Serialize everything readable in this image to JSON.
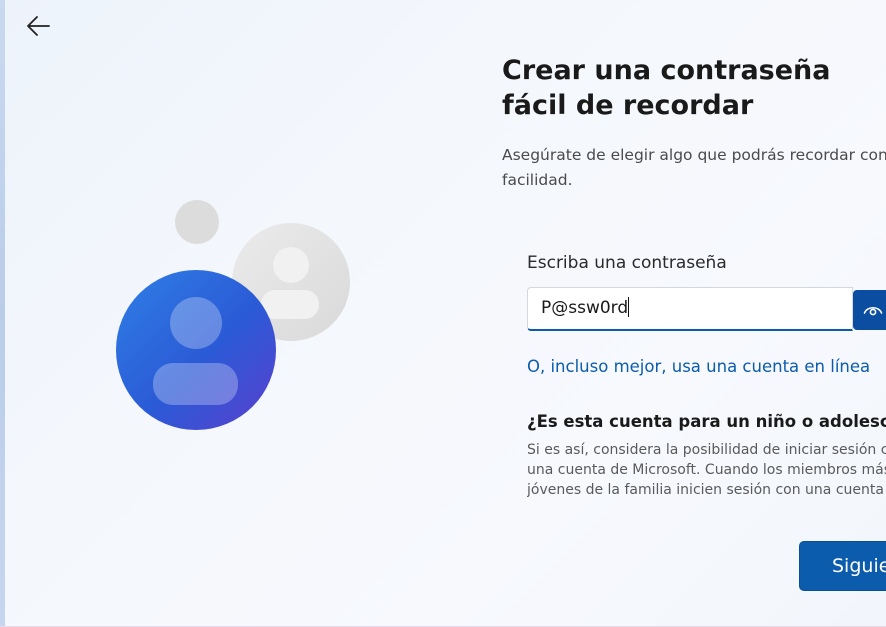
{
  "header": {
    "back_icon": "arrow-left-icon"
  },
  "main": {
    "title": "Crear una contraseña fácil de recordar",
    "subtitle_line1": "Asegúrate de elegir algo que podrás recordar con",
    "subtitle_line2": "facilidad.",
    "password_label": "Escriba una contraseña",
    "password_value": "P@ssw0rd",
    "reveal_icon": "eye-icon",
    "online_account_link": "O, incluso mejor, usa una cuenta en línea",
    "child_heading": "¿Es esta cuenta para un niño o adolescente?",
    "child_body_line1": "Si es así, considera la posibilidad de iniciar sesión con",
    "child_body_line2": "una cuenta de Microsoft. Cuando los miembros más",
    "child_body_line3": "jóvenes de la familia inicien sesión con una cuenta de",
    "next_label": "Siguiente"
  },
  "colors": {
    "accent": "#0b5cad",
    "avatar_front": "#2b5fd9",
    "avatar_back": "#e3e3e3"
  }
}
